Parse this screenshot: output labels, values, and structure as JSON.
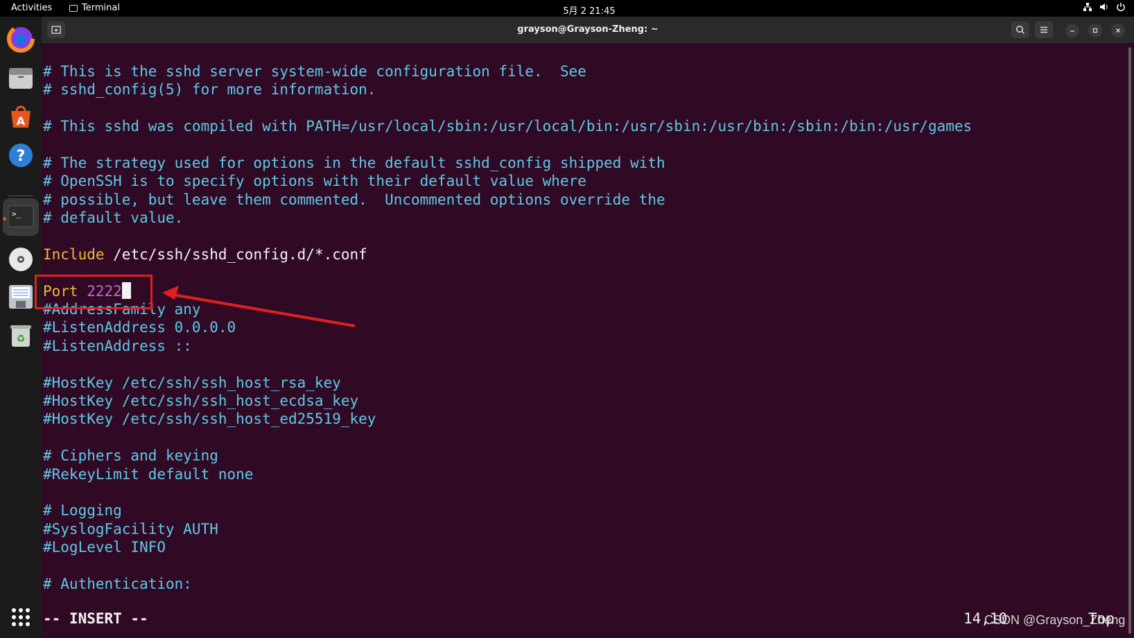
{
  "topbar": {
    "activities": "Activities",
    "app_name": "Terminal",
    "clock": "5月 2  21:45"
  },
  "dock": {
    "items": [
      {
        "name": "firefox",
        "icon": "firefox-icon"
      },
      {
        "name": "files",
        "icon": "files-icon"
      },
      {
        "name": "software",
        "icon": "app-center-icon"
      },
      {
        "name": "help",
        "icon": "help-icon"
      },
      {
        "name": "terminal",
        "icon": "terminal-icon",
        "active": true
      },
      {
        "name": "disc",
        "icon": "disc-icon"
      },
      {
        "name": "save",
        "icon": "floppy-icon"
      },
      {
        "name": "trash",
        "icon": "trash-icon"
      },
      {
        "name": "apps",
        "icon": "app-grid-icon"
      }
    ]
  },
  "window": {
    "title": "grayson@Grayson-Zheng: ~"
  },
  "editor": {
    "lines": [
      {
        "type": "comment",
        "text": "# This is the sshd server system-wide configuration file.  See"
      },
      {
        "type": "comment",
        "text": "# sshd_config(5) for more information."
      },
      {
        "type": "blank",
        "text": ""
      },
      {
        "type": "comment",
        "text": "# This sshd was compiled with PATH=/usr/local/sbin:/usr/local/bin:/usr/sbin:/usr/bin:/sbin:/bin:/usr/games"
      },
      {
        "type": "blank",
        "text": ""
      },
      {
        "type": "comment",
        "text": "# The strategy used for options in the default sshd_config shipped with"
      },
      {
        "type": "comment",
        "text": "# OpenSSH is to specify options with their default value where"
      },
      {
        "type": "comment",
        "text": "# possible, but leave them commented.  Uncommented options override the"
      },
      {
        "type": "comment",
        "text": "# default value."
      },
      {
        "type": "blank",
        "text": ""
      },
      {
        "type": "directive",
        "keyword": "Include",
        "value": " /etc/ssh/sshd_config.d/*.conf",
        "value_style": "plain"
      },
      {
        "type": "blank",
        "text": ""
      },
      {
        "type": "directive",
        "keyword": "Port",
        "value": " 2222",
        "value_style": "val",
        "cursor": true
      },
      {
        "type": "comment",
        "text": "#AddressFamily any"
      },
      {
        "type": "comment",
        "text": "#ListenAddress 0.0.0.0"
      },
      {
        "type": "comment",
        "text": "#ListenAddress ::"
      },
      {
        "type": "blank",
        "text": ""
      },
      {
        "type": "comment",
        "text": "#HostKey /etc/ssh/ssh_host_rsa_key"
      },
      {
        "type": "comment",
        "text": "#HostKey /etc/ssh/ssh_host_ecdsa_key"
      },
      {
        "type": "comment",
        "text": "#HostKey /etc/ssh/ssh_host_ed25519_key"
      },
      {
        "type": "blank",
        "text": ""
      },
      {
        "type": "comment",
        "text": "# Ciphers and keying"
      },
      {
        "type": "comment",
        "text": "#RekeyLimit default none"
      },
      {
        "type": "blank",
        "text": ""
      },
      {
        "type": "comment",
        "text": "# Logging"
      },
      {
        "type": "comment",
        "text": "#SyslogFacility AUTH"
      },
      {
        "type": "comment",
        "text": "#LogLevel INFO"
      },
      {
        "type": "blank",
        "text": ""
      },
      {
        "type": "comment",
        "text": "# Authentication:"
      }
    ],
    "mode": "-- INSERT --",
    "cursor_pos": "14,10",
    "scroll_pos": "Top"
  },
  "watermark": "CSDN @Grayson_Zheng",
  "colors": {
    "background": "#300a24",
    "comment": "#5ec9e8",
    "keyword": "#f0b83a",
    "value": "#c46ad2",
    "annotation": "#e02020"
  }
}
